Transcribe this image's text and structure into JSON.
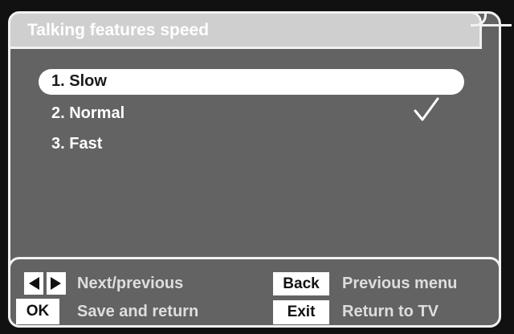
{
  "title": "Talking features speed",
  "menu": {
    "items": [
      {
        "label": "1. Slow"
      },
      {
        "label": "2. Normal"
      },
      {
        "label": "3. Fast"
      }
    ]
  },
  "legend": {
    "nav_text": "Next/previous",
    "ok_key": "OK",
    "ok_text": "Save and return",
    "back_key": "Back",
    "back_text": "Previous menu",
    "exit_key": "Exit",
    "exit_text": "Return to TV"
  },
  "icons": {
    "check": "check-icon",
    "left": "left-arrow-icon",
    "right": "right-arrow-icon"
  },
  "colors": {
    "panel": "#636363",
    "title_bar": "#cfcfcf",
    "highlight": "#ffffff",
    "border": "#f2f2f2"
  }
}
